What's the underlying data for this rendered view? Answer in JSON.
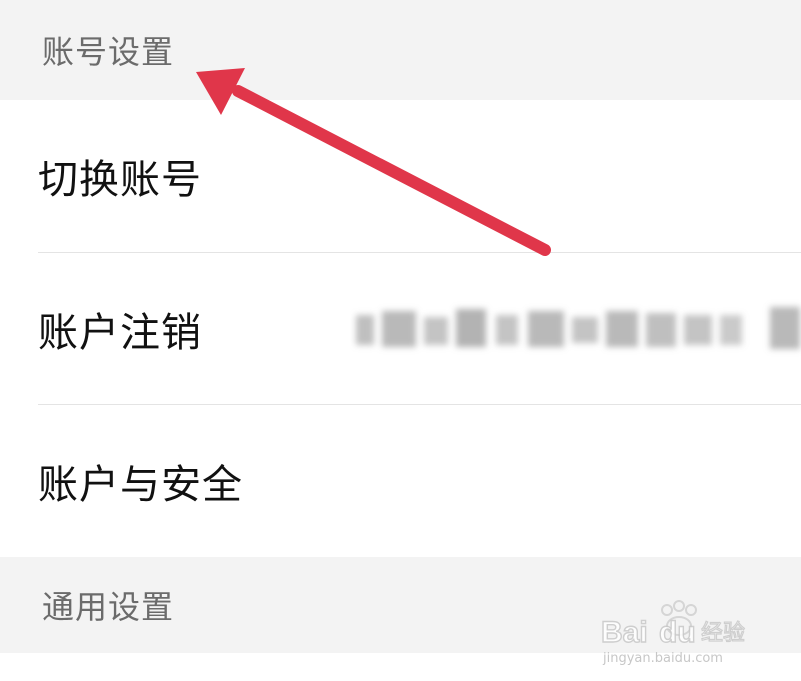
{
  "sections": {
    "account": {
      "title": "账号设置",
      "rows": [
        {
          "label": "切换账号"
        },
        {
          "label": "账户注销",
          "value_blurred": true
        },
        {
          "label": "账户与安全"
        }
      ]
    },
    "general": {
      "title": "通用设置"
    }
  },
  "annotation": {
    "arrow_color": "#e0364a"
  },
  "watermark": {
    "brand": "Baidu经验",
    "url": "jingyan.baidu.com"
  },
  "colors": {
    "header_bg": "#f3f3f3",
    "header_text": "#6b6b6b",
    "row_text": "#111111",
    "divider": "#e4e4e4"
  }
}
